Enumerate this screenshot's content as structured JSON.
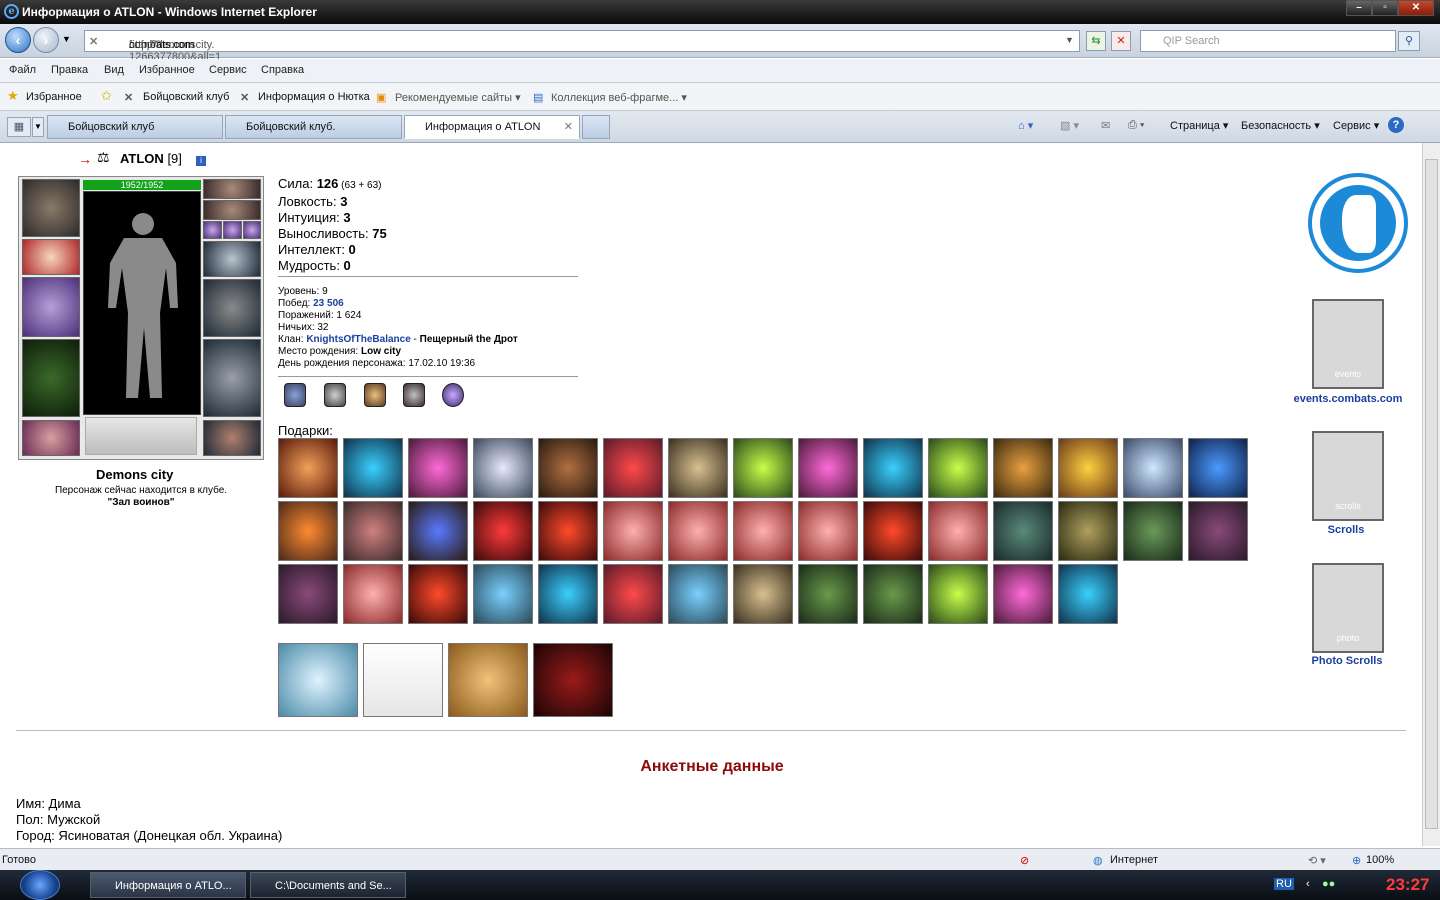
{
  "window": {
    "title": "Информация о ATLON - Windows Internet Explorer",
    "ie_letter": "e",
    "min": "–",
    "max": "▫",
    "close": "✕"
  },
  "address": {
    "url_prefix": "http://demonscity.",
    "url_domain": "combats.com",
    "url_suffix": "/inf.pl?1266377800&all=1",
    "search_placeholder": "QIP Search"
  },
  "menu": [
    "Файл",
    "Правка",
    "Вид",
    "Избранное",
    "Сервис",
    "Справка"
  ],
  "favorites": {
    "label": "Избранное",
    "links": [
      "Бойцовский клуб",
      "Информация о Нютка",
      "Рекомендуемые сайты ▾",
      "Коллекция веб-фрагме... ▾"
    ]
  },
  "tabs": [
    "Бойцовский клуб",
    "Бойцовский клуб.",
    "Информация о ATLON"
  ],
  "toolbar": {
    "page": "Страница ▾",
    "security": "Безопасность ▾",
    "service": "Сервис ▾",
    "help": "?"
  },
  "character": {
    "name": "ATLON",
    "level": "[9]",
    "info": "i",
    "hp": "1952/1952",
    "city": "Demons city",
    "location_text": "Персонаж сейчас находится в клубе.",
    "location_room": "\"Зал воинов\""
  },
  "stats": [
    {
      "label": "Сила: ",
      "value": "126",
      "extra": " (63 + 63)"
    },
    {
      "label": "Ловкость: ",
      "value": "3",
      "extra": ""
    },
    {
      "label": "Интуиция: ",
      "value": "3",
      "extra": ""
    },
    {
      "label": "Выносливость: ",
      "value": "75",
      "extra": ""
    },
    {
      "label": "Интеллект: ",
      "value": "0",
      "extra": ""
    },
    {
      "label": "Мудрость: ",
      "value": "0",
      "extra": ""
    }
  ],
  "info": {
    "level": "Уровень: 9",
    "wins_label": "Побед: ",
    "wins": "23 506",
    "losses": "Поражений: 1 624",
    "draws": "Ничьих: 32",
    "clan_label": "Клан: ",
    "clan": "KnightsOfTheBalance",
    "clan_sep": " - ",
    "clan_title": "Пещерный the Дрот",
    "birthplace_label": "Место рождения: ",
    "birthplace": "Low city",
    "birthday": "День рождения персонажа: 17.02.10 19:36"
  },
  "gifts_label": "Подарки:",
  "profile": {
    "heading": "Анкетные данные",
    "name": "Имя: Дима",
    "sex": "Пол: Мужской",
    "city": "Город: Ясиноватая (Донецкая обл. Украина)"
  },
  "side": {
    "events": "events.combats.com",
    "events_banner": "events",
    "scrolls": "Scrolls",
    "scrolls_banner": "scrolls",
    "photo": "Photo Scrolls",
    "photo_banner": "photo"
  },
  "status": {
    "ready": "Готово",
    "zone": "Интернет",
    "zoom": "100%"
  },
  "taskbar": {
    "task1": "Информация о ATLO...",
    "task2": "C:\\Documents and Se...",
    "lang": "RU",
    "time": "23:27"
  },
  "colors": {
    "link": "#1a3fa0",
    "heading": "#8b0b0b",
    "hp": "#13a31a"
  },
  "gift_row1": [
    "c1",
    "c2",
    "c3",
    "c4",
    "c5",
    "c6",
    "c7",
    "c8",
    "c3",
    "c2",
    "c8",
    "c9",
    "c10",
    "c11",
    "c12"
  ],
  "gift_row2": [
    "c13",
    "c14",
    "c15",
    "c16",
    "c17",
    "c18",
    "c18",
    "c18",
    "c18",
    "c17",
    "c18",
    "c19",
    "c20",
    "c21",
    "c22"
  ],
  "gift_row3": [
    "c22",
    "c18",
    "c17",
    "c23",
    "c2",
    "c6",
    "c23",
    "c7",
    "c24",
    "c24",
    "c8",
    "c3",
    "c2"
  ]
}
